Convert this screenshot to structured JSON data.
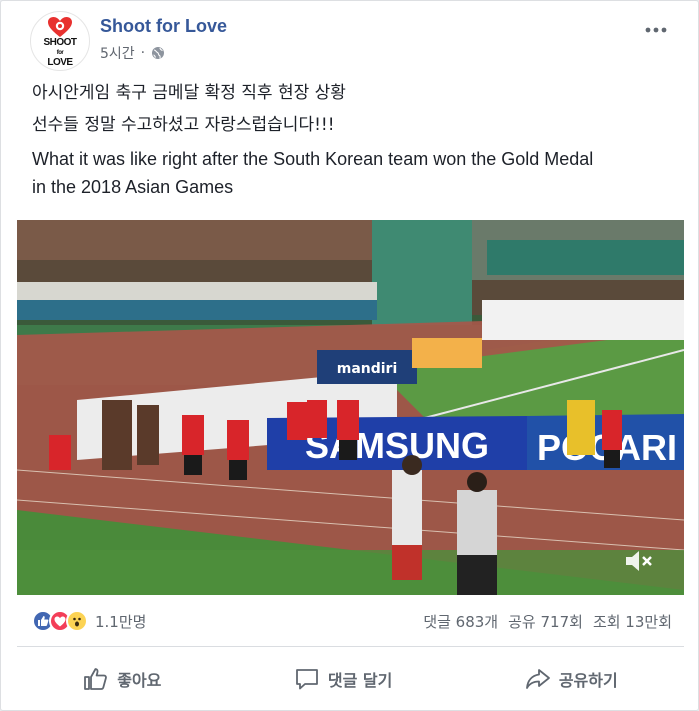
{
  "post": {
    "page_name": "Shoot for Love",
    "time": "5시간",
    "separator": "·",
    "avatar_text": "SHOOT\nfor\nLOVE",
    "more_icon": "more-dots-icon",
    "text_lines": [
      "아시안게임 축구 금메달 확정 직후 현장 상황",
      "선수들 정말 수고하셨고 자랑스럽습니다!!!",
      "What it was like right after the South Korean team won the Gold Medal",
      "in the 2018 Asian Games"
    ]
  },
  "photo": {
    "banners": [
      "SAMSUNG",
      "POCARI",
      "mandiri"
    ]
  },
  "stats": {
    "reaction_count": "1.1만명",
    "comments": "댓글 683개",
    "shares": "공유 717회",
    "views": "조회 13만회"
  },
  "actions": {
    "like": "좋아요",
    "comment": "댓글 달기",
    "share": "공유하기"
  },
  "colors": {
    "brand": "#365899",
    "like": "#4267b2",
    "love": "#f33e58",
    "wow": "#fcd354",
    "text_muted": "#606770"
  }
}
